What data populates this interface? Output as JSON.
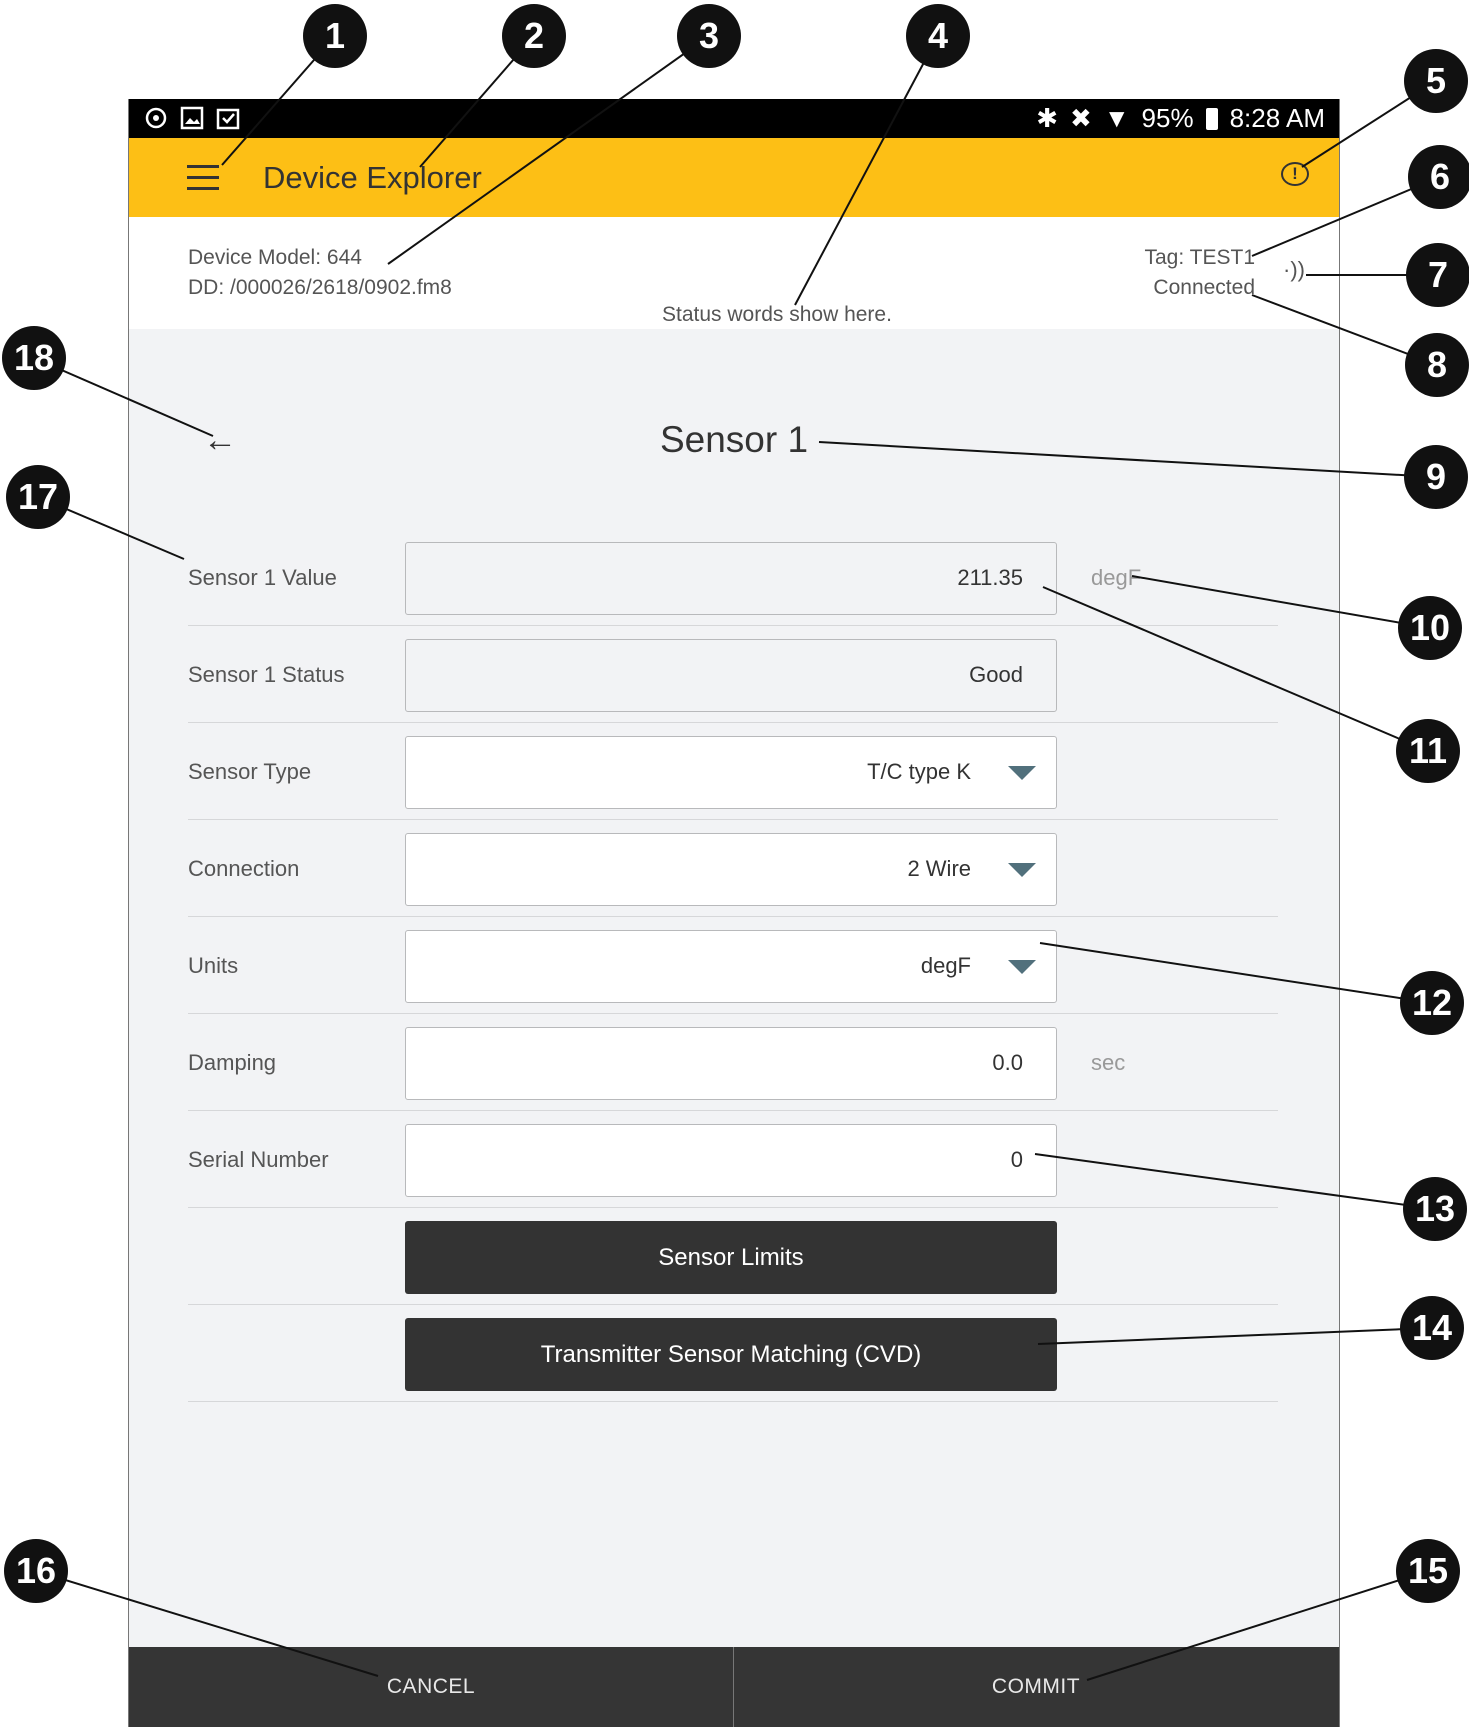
{
  "statusbar": {
    "icons_left": [
      "sync-icon",
      "image-icon",
      "clipboard-icon"
    ],
    "icons_right": [
      "bluetooth-icon",
      "mute-icon",
      "wifi-icon"
    ],
    "battery": "95%",
    "time": "8:28 AM"
  },
  "appbar": {
    "title": "Device Explorer",
    "menu_icon": "hamburger-icon",
    "alert_icon": "alert-bubble-icon",
    "alert_glyph": "!",
    "color": "#fdbf15"
  },
  "device": {
    "model": "Device Model:  644",
    "dd": "DD:  /000026/2618/0902.fm8",
    "status_words": "Status words show here.",
    "tag": "Tag:  TEST1",
    "connection": "Connected",
    "signal_icon": "signal-icon"
  },
  "page": {
    "title": "Sensor 1",
    "back_icon": "back-arrow-icon"
  },
  "fields": {
    "sensor_value": {
      "label": "Sensor 1 Value",
      "value": "211.35",
      "unit": "degF"
    },
    "sensor_status": {
      "label": "Sensor 1 Status",
      "value": "Good"
    },
    "sensor_type": {
      "label": "Sensor Type",
      "value": "T/C type K"
    },
    "connection": {
      "label": "Connection",
      "value": "2 Wire"
    },
    "units": {
      "label": "Units",
      "value": "degF"
    },
    "damping": {
      "label": "Damping",
      "value": "0.0",
      "unit": "sec"
    },
    "serial": {
      "label": "Serial Number",
      "value": "0"
    }
  },
  "buttons": {
    "sensor_limits": "Sensor Limits",
    "cvd": "Transmitter Sensor Matching (CVD)",
    "cancel": "CANCEL",
    "commit": "COMMIT"
  },
  "callouts": [
    "1",
    "2",
    "3",
    "4",
    "5",
    "6",
    "7",
    "8",
    "9",
    "10",
    "11",
    "12",
    "13",
    "14",
    "15",
    "16",
    "17",
    "18"
  ]
}
